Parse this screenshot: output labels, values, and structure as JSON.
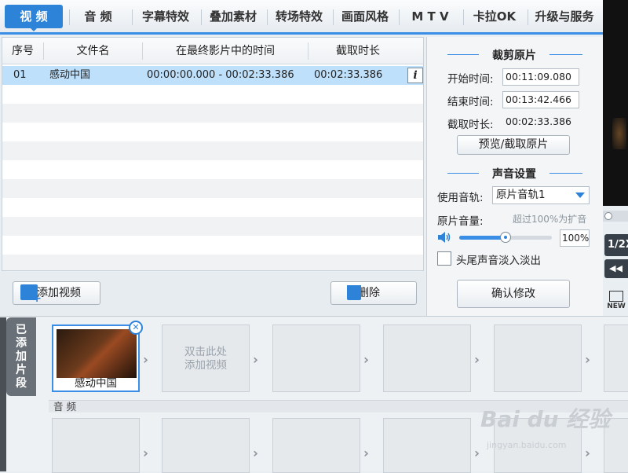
{
  "tabs": [
    "视 频",
    "音 频",
    "字幕特效",
    "叠加素材",
    "转场特效",
    "画面风格",
    "M T V",
    "卡拉OK",
    "升级与服务"
  ],
  "table": {
    "headers": [
      "序号",
      "文件名",
      "在最终影片中的时间",
      "截取时长"
    ],
    "rows": [
      {
        "index": "01",
        "filename": "感动中国",
        "time_range": "00:00:00.000 - 00:02:33.386",
        "duration": "00:02:33.386"
      }
    ],
    "info_icon": "i"
  },
  "buttons": {
    "add_video": "添加视频",
    "delete": "删除",
    "confirm": "确认修改",
    "preview_cut": "预览/截取原片"
  },
  "clip": {
    "section_title": "裁剪原片",
    "start_label": "开始时间:",
    "start_value": "00:11:09.080",
    "end_label": "结束时间:",
    "end_value": "00:13:42.466",
    "duration_label": "截取时长:",
    "duration_value": "00:02:33.386"
  },
  "sound": {
    "section_title": "声音设置",
    "track_label": "使用音轨:",
    "track_value": "原片音轨1",
    "volume_label": "原片音量:",
    "volume_hint": "超过100%为扩音",
    "volume_value": "100%",
    "volume_level": 0.5,
    "fade_label": "头尾声音淡入淡出"
  },
  "segments": {
    "side_label": "已添加片段",
    "first_clip_name": "感动中国",
    "empty_hint_line1": "双击此处",
    "empty_hint_line2": "添加视频",
    "audio_label": "音 频"
  },
  "player": {
    "speed": "1/2X",
    "rewind": "◀◀",
    "new_badge": "NEW"
  },
  "watermark": {
    "text": "Bai du 经验",
    "sub": "jingyan.baidu.com"
  },
  "colors": {
    "accent": "#2d83d8",
    "selected_row": "#bfe0fb"
  }
}
